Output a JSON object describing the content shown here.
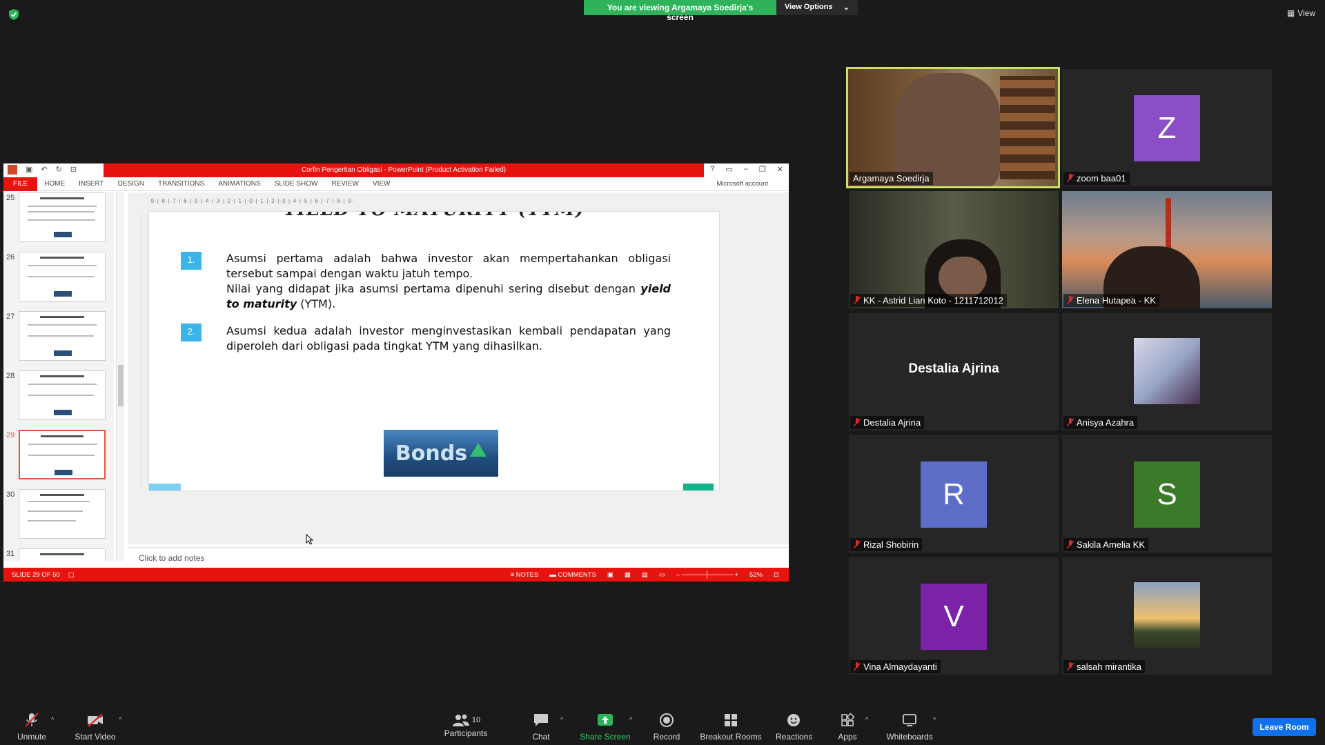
{
  "banner": {
    "viewing": "You are viewing Argamaya Soedirja's screen",
    "view_options": "View Options",
    "view": "View"
  },
  "ppt": {
    "title": "Corfin Pengertian Obligasi - PowerPoint (Product Activation Failed)",
    "tabs": [
      "FILE",
      "HOME",
      "INSERT",
      "DESIGN",
      "TRANSITIONS",
      "ANIMATIONS",
      "SLIDE SHOW",
      "REVIEW",
      "VIEW"
    ],
    "account": "Microsoft account",
    "ruler": "·9·|·8·|·7·|·6·|·5·|·4·|·3·|·2·|·1·|·0·|·1·|·2·|·3·|·4·|·5·|·6·|·7·|·8·|·9·",
    "thumb_numbers": [
      "25",
      "26",
      "27",
      "28",
      "29",
      "30",
      "31"
    ],
    "selected_slide": "29",
    "slide": {
      "title": "YIELD TO MATURITY (YTM)",
      "bullet1_num": "1.",
      "bullet1_line1": "Asumsi pertama adalah bahwa investor akan mempertahankan obligasi tersebut sampai dengan waktu jatuh tempo.",
      "bullet1_line2_a": "Nilai yang didapat jika asumsi pertama dipenuhi sering disebut dengan ",
      "bullet1_line2_b": "yield to maturity",
      "bullet1_line2_c": " (YTM).",
      "bullet2_num": "2.",
      "bullet2_text": "Asumsi kedua adalah investor menginvestasikan kembali pendapatan yang diperoleh dari obligasi pada tingkat YTM yang dihasilkan.",
      "image_text": "Bonds"
    },
    "notes_placeholder": "Click to add notes",
    "status": {
      "slide": "SLIDE 29 OF 50",
      "notes": "NOTES",
      "comments": "COMMENTS",
      "zoom": "52%"
    }
  },
  "gallery": [
    {
      "name": "Argamaya Soedirja",
      "type": "video",
      "active": true,
      "muted": false
    },
    {
      "name": "zoom baa01",
      "type": "avatar",
      "letter": "Z",
      "color": "#8b4ec6",
      "muted": true
    },
    {
      "name": "KK - Astrid Lian Koto - 1211712012",
      "type": "video",
      "muted": true
    },
    {
      "name": "Elena Hutapea - KK",
      "type": "video",
      "muted": true
    },
    {
      "name": "Destalia Ajrina",
      "type": "name",
      "muted": true
    },
    {
      "name": "Anisya Azahra",
      "type": "photo",
      "muted": true
    },
    {
      "name": "Rizal Shobirin",
      "type": "avatar",
      "letter": "R",
      "color": "#5e6ec8",
      "muted": true
    },
    {
      "name": "Sakila Amelia KK",
      "type": "avatar",
      "letter": "S",
      "color": "#3a7a28",
      "muted": true
    },
    {
      "name": "Vina Almaydayanti",
      "type": "avatar",
      "letter": "V",
      "color": "#7b22a8",
      "muted": true
    },
    {
      "name": "salsah mirantika",
      "type": "photo",
      "muted": true
    }
  ],
  "toolbar": {
    "unmute": "Unmute",
    "start_video": "Start Video",
    "participants": "Participants",
    "participants_count": "10",
    "chat": "Chat",
    "share_screen": "Share Screen",
    "record": "Record",
    "breakout": "Breakout Rooms",
    "reactions": "Reactions",
    "apps": "Apps",
    "whiteboards": "Whiteboards",
    "leave": "Leave Room"
  },
  "colors": {
    "accent_green": "#2fb35a",
    "ppt_red": "#e6130f",
    "leave_blue": "#0e71eb",
    "active_border": "#c9e265"
  }
}
